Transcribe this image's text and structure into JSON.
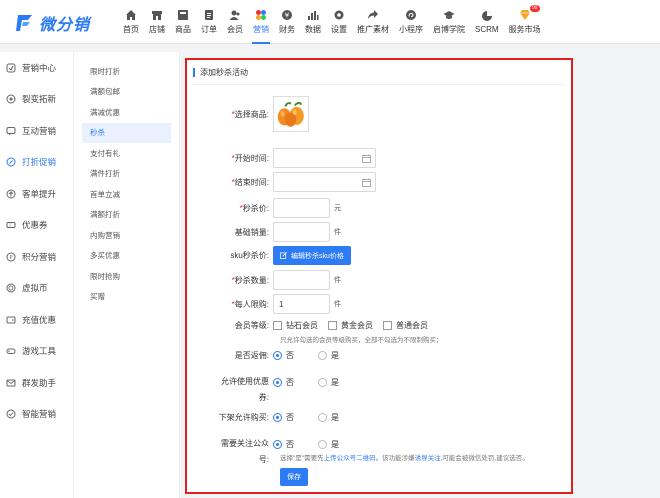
{
  "brand": {
    "name": "微分销"
  },
  "nav": [
    {
      "label": "首页",
      "icon": "home-icon"
    },
    {
      "label": "店铺",
      "icon": "store-icon"
    },
    {
      "label": "商品",
      "icon": "goods-icon"
    },
    {
      "label": "订单",
      "icon": "order-icon"
    },
    {
      "label": "会员",
      "icon": "member-icon"
    },
    {
      "label": "营销",
      "icon": "marketing-icon"
    },
    {
      "label": "财务",
      "icon": "finance-icon"
    },
    {
      "label": "数据",
      "icon": "data-icon"
    },
    {
      "label": "设置",
      "icon": "settings-icon"
    },
    {
      "label": "推广素材",
      "icon": "share-icon"
    },
    {
      "label": "小程序",
      "icon": "miniapp-icon"
    },
    {
      "label": "启博学院",
      "icon": "academy-icon"
    },
    {
      "label": "SCRM",
      "icon": "scrm-icon"
    },
    {
      "label": "服务市场",
      "icon": "market-icon",
      "badge": "99"
    }
  ],
  "left_nav": [
    "营销中心",
    "裂变拓新",
    "互动营销",
    "打折促销",
    "客单提升",
    "优惠券",
    "积分营销",
    "虚拟币",
    "充值优惠",
    "游戏工具",
    "群发助手",
    "智能营销"
  ],
  "sub_nav": [
    "限时打折",
    "满额包邮",
    "满减优惠",
    "秒杀",
    "支付有礼",
    "满件打折",
    "首单立减",
    "满额打折",
    "内购营销",
    "多买优惠",
    "限时抢购",
    "买赠"
  ],
  "form": {
    "title": "添加秒杀活动",
    "product_label": "选择商品:",
    "start_label": "开始时间:",
    "end_label": "结束时间:",
    "price_label": "秒杀价:",
    "price_unit": "元",
    "base_sales_label": "基础销量:",
    "base_sales_unit": "件",
    "sku_label": "sku秒杀价:",
    "sku_button": "编辑秒杀sku价格",
    "quantity_label": "秒杀数量:",
    "quantity_unit": "件",
    "limit_label": "每人限购:",
    "limit_value": "1",
    "limit_unit": "件",
    "level_label": "会员等级:",
    "levels": [
      "钻石会员",
      "黄金会员",
      "普通会员"
    ],
    "level_hint": "只允许勾选的会员等级购买，全部不勾选为不限制购买；",
    "rebate_label": "是否返佣:",
    "coupon_label_1": "允许使用优惠",
    "coupon_label_2": "券:",
    "delist_label": "下架允许购买:",
    "follow_label_1": "需要关注公众",
    "follow_label_2": "号:",
    "no": "否",
    "yes": "是",
    "follow_hint_a": "选择\"是\"需要先",
    "follow_hint_link1": "上传公众号二维码",
    "follow_hint_b": "。该功能涉嫌",
    "follow_hint_link2": "诱导关注",
    "follow_hint_c": ",可能会被微信处罚,建议选否。",
    "save": "保存"
  },
  "colors": {
    "accent": "#2e7bf6",
    "highlight": "#e02020"
  }
}
